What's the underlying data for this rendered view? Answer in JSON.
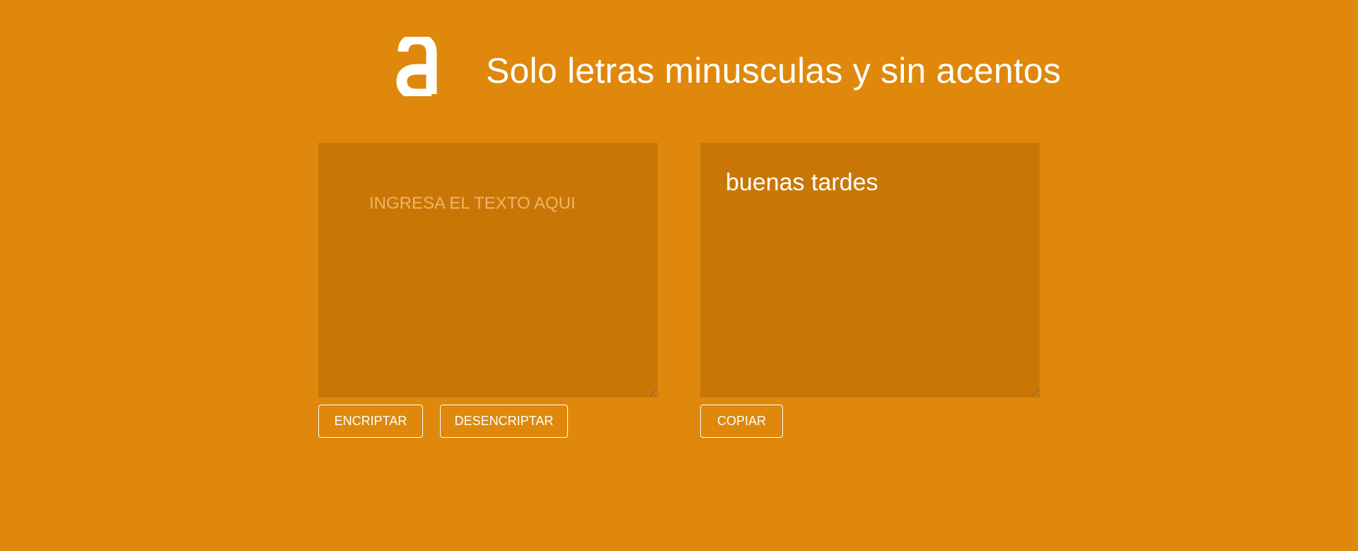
{
  "header": {
    "logo_icon": "alura-a-logo-icon",
    "title": "Solo letras minusculas y sin acentos"
  },
  "input_panel": {
    "placeholder": "INGRESA EL TEXTO AQUI",
    "value": ""
  },
  "output_panel": {
    "value": "buenas tardes"
  },
  "buttons": {
    "encrypt": "ENCRIPTAR",
    "decrypt": "DESENCRIPTAR",
    "copy": "COPIAR"
  },
  "colors": {
    "background": "#df880b",
    "panel": "#c87707",
    "text": "#ffffff",
    "placeholder": "#f0b466"
  }
}
